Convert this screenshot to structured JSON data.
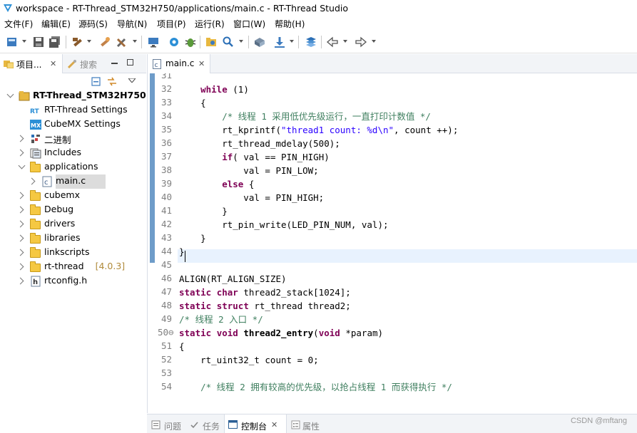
{
  "window": {
    "title": "workspace - RT-Thread_STM32H750/applications/main.c - RT-Thread Studio"
  },
  "menu": [
    "文件(F)",
    "编辑(E)",
    "源码(S)",
    "导航(N)",
    "项目(P)",
    "运行(R)",
    "窗口(W)",
    "帮助(H)"
  ],
  "toolbar": {
    "icons": [
      "new-icon",
      "save-icon",
      "save-all-icon",
      "build-icon",
      "clean-icon",
      "tools-icon",
      "monitor-icon",
      "settings-gear-icon",
      "debug-bug-icon",
      "open-folder-icon",
      "search-icon",
      "package-icon",
      "download-icon",
      "layers-icon",
      "back-arrow-icon",
      "forward-arrow-icon"
    ]
  },
  "left_panel": {
    "tabs": [
      {
        "label": "项目...",
        "icon": "project-explorer-icon"
      },
      {
        "label": "搜索",
        "icon": "search-icon"
      }
    ],
    "tree": [
      {
        "label": "RT-Thread_STM32H750",
        "depth": 0,
        "expand": "down",
        "icon": "project-icon",
        "bold": true
      },
      {
        "label": "RT-Thread Settings",
        "depth": 1,
        "expand": "none",
        "icon": "rt-settings-icon"
      },
      {
        "label": "CubeMX Settings",
        "depth": 1,
        "expand": "none",
        "icon": "cubemx-icon"
      },
      {
        "label": "二进制",
        "depth": 1,
        "expand": "right",
        "icon": "binaries-icon"
      },
      {
        "label": "Includes",
        "depth": 1,
        "expand": "right",
        "icon": "includes-icon"
      },
      {
        "label": "applications",
        "depth": 1,
        "expand": "down",
        "icon": "folder-icon"
      },
      {
        "label": "main.c",
        "depth": 2,
        "expand": "right",
        "icon": "c-file-icon",
        "selected": true
      },
      {
        "label": "cubemx",
        "depth": 1,
        "expand": "right",
        "icon": "folder-icon"
      },
      {
        "label": "Debug",
        "depth": 1,
        "expand": "right",
        "icon": "folder-icon"
      },
      {
        "label": "drivers",
        "depth": 1,
        "expand": "right",
        "icon": "folder-icon"
      },
      {
        "label": "libraries",
        "depth": 1,
        "expand": "right",
        "icon": "folder-icon"
      },
      {
        "label": "linkscripts",
        "depth": 1,
        "expand": "right",
        "icon": "folder-icon"
      },
      {
        "label": "rt-thread",
        "depth": 1,
        "expand": "right",
        "icon": "folder-icon",
        "suffix": "[4.0.3]"
      },
      {
        "label": "rtconfig.h",
        "depth": 1,
        "expand": "right",
        "icon": "h-file-icon"
      }
    ]
  },
  "editor": {
    "tab_label": "main.c",
    "lines": [
      {
        "n": "31",
        "segs": []
      },
      {
        "n": "32",
        "segs": [
          [
            "    ",
            ""
          ],
          [
            "while",
            "kw"
          ],
          [
            " (1)",
            ""
          ]
        ]
      },
      {
        "n": "33",
        "segs": [
          [
            "    {",
            ""
          ]
        ]
      },
      {
        "n": "34",
        "segs": [
          [
            "        ",
            ""
          ],
          [
            "/* 线程 1 采用低优先级运行，一直打印计数值 */",
            "cm"
          ]
        ]
      },
      {
        "n": "35",
        "segs": [
          [
            "        rt_kprintf(",
            ""
          ],
          [
            "\"thread1 count: %d\\n\"",
            "str"
          ],
          [
            ", count ++);",
            ""
          ]
        ]
      },
      {
        "n": "36",
        "segs": [
          [
            "        rt_thread_mdelay(500);",
            ""
          ]
        ]
      },
      {
        "n": "37",
        "segs": [
          [
            "        ",
            ""
          ],
          [
            "if",
            "kw"
          ],
          [
            "( val == PIN_HIGH)",
            ""
          ]
        ]
      },
      {
        "n": "38",
        "segs": [
          [
            "            val = PIN_LOW;",
            ""
          ]
        ]
      },
      {
        "n": "39",
        "segs": [
          [
            "        ",
            ""
          ],
          [
            "else",
            "kw"
          ],
          [
            " {",
            ""
          ]
        ]
      },
      {
        "n": "40",
        "segs": [
          [
            "            val = PIN_HIGH;",
            ""
          ]
        ]
      },
      {
        "n": "41",
        "segs": [
          [
            "        }",
            ""
          ]
        ]
      },
      {
        "n": "42",
        "segs": [
          [
            "        rt_pin_write(LED_PIN_NUM, val);",
            ""
          ]
        ]
      },
      {
        "n": "43",
        "segs": [
          [
            "    }",
            ""
          ]
        ]
      },
      {
        "n": "44",
        "segs": [
          [
            "}",
            ""
          ]
        ]
      },
      {
        "n": "45",
        "segs": []
      },
      {
        "n": "46",
        "segs": [
          [
            "ALIGN(RT_ALIGN_SIZE)",
            ""
          ]
        ]
      },
      {
        "n": "47",
        "segs": [
          [
            "static",
            "kw"
          ],
          [
            " ",
            ""
          ],
          [
            "char",
            "kw"
          ],
          [
            " thread2_stack[1024];",
            ""
          ]
        ]
      },
      {
        "n": "48",
        "segs": [
          [
            "static",
            "kw"
          ],
          [
            " ",
            ""
          ],
          [
            "struct",
            "kw"
          ],
          [
            " rt_thread thread2;",
            ""
          ]
        ]
      },
      {
        "n": "49",
        "segs": [
          [
            "/* 线程 2 入口 */",
            "cm"
          ]
        ]
      },
      {
        "n": "50⊖",
        "segs": [
          [
            "static",
            "kw"
          ],
          [
            " ",
            ""
          ],
          [
            "void",
            "kw"
          ],
          [
            " ",
            ""
          ],
          [
            "thread2_entry",
            "fn"
          ],
          [
            "(",
            ""
          ],
          [
            "void",
            "kw"
          ],
          [
            " *param)",
            ""
          ]
        ]
      },
      {
        "n": "51",
        "segs": [
          [
            "{",
            ""
          ]
        ]
      },
      {
        "n": "52",
        "segs": [
          [
            "    rt_uint32_t count = 0;",
            ""
          ]
        ]
      },
      {
        "n": "53",
        "segs": []
      },
      {
        "n": "54",
        "segs": [
          [
            "    ",
            ""
          ],
          [
            "/* 线程 2 拥有较高的优先级，以抢占线程 1 而获得执行 */",
            "cm"
          ]
        ]
      }
    ]
  },
  "bottom_tabs": [
    {
      "label": "问题",
      "icon": "problems-icon"
    },
    {
      "label": "任务",
      "icon": "tasks-icon"
    },
    {
      "label": "控制台",
      "icon": "console-icon",
      "active": true
    },
    {
      "label": "属性",
      "icon": "properties-icon"
    }
  ],
  "watermark": "CSDN @mftang"
}
